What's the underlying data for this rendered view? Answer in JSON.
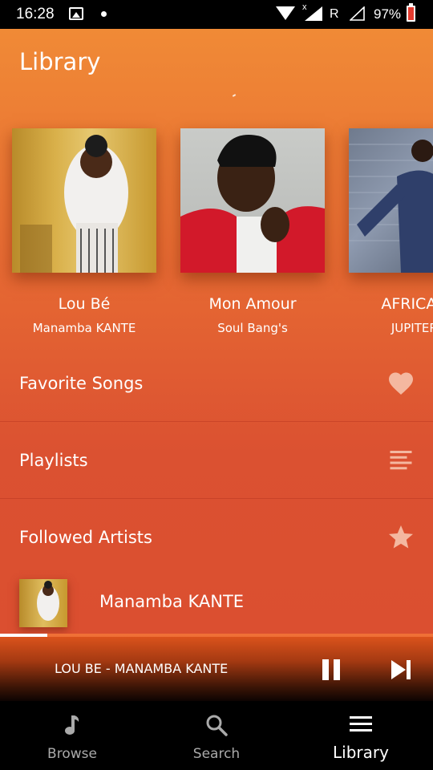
{
  "status_bar": {
    "time": "16:28",
    "network_roaming": "R",
    "network_x": "x",
    "battery": "97%"
  },
  "header": {
    "title": "Library"
  },
  "recent_albums": [
    {
      "title": "Lou Bé",
      "artist": "Manamba KANTE"
    },
    {
      "title": "Mon Amour",
      "artist": "Soul Bang's"
    },
    {
      "title": "AFRICA By",
      "artist": "JUPITER D"
    }
  ],
  "sections": {
    "favorites": {
      "label": "Favorite Songs",
      "icon": "heart-icon"
    },
    "playlists": {
      "label": "Playlists",
      "icon": "list-icon"
    },
    "followed": {
      "label": "Followed Artists",
      "icon": "star-icon"
    }
  },
  "followed_artists": [
    {
      "name": "Manamba KANTE"
    }
  ],
  "player": {
    "now_playing": "LOU BE - MANAMBA KANTE",
    "progress": 0.11
  },
  "bottom_nav": {
    "browse": "Browse",
    "search": "Search",
    "library": "Library",
    "active": "library"
  },
  "colors": {
    "accent": "#e86d33",
    "icon_muted": "#f4b8a0"
  }
}
